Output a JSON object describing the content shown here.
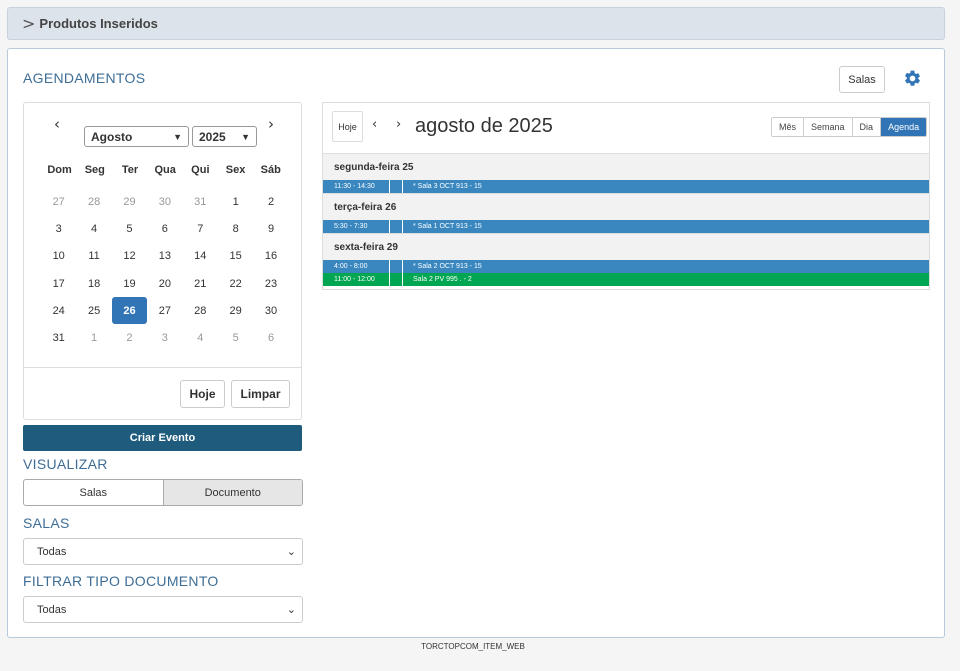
{
  "collapse": {
    "chevron": ">",
    "title": "Produtos Inseridos"
  },
  "section_title": "AGENDAMENTOS",
  "header_buttons": {
    "salas": "Salas",
    "gear": "gear-icon"
  },
  "mini_calendar": {
    "prev": "‹",
    "next": "›",
    "month": "Agosto",
    "year": "2025",
    "weekdays": [
      "Dom",
      "Seg",
      "Ter",
      "Qua",
      "Qui",
      "Sex",
      "Sáb"
    ],
    "days": [
      {
        "n": "27",
        "out": true
      },
      {
        "n": "28",
        "out": true
      },
      {
        "n": "29",
        "out": true
      },
      {
        "n": "30",
        "out": true
      },
      {
        "n": "31",
        "out": true
      },
      {
        "n": "1"
      },
      {
        "n": "2"
      },
      {
        "n": "3"
      },
      {
        "n": "4"
      },
      {
        "n": "5"
      },
      {
        "n": "6"
      },
      {
        "n": "7"
      },
      {
        "n": "8"
      },
      {
        "n": "9"
      },
      {
        "n": "10"
      },
      {
        "n": "11"
      },
      {
        "n": "12"
      },
      {
        "n": "13"
      },
      {
        "n": "14"
      },
      {
        "n": "15"
      },
      {
        "n": "16"
      },
      {
        "n": "17"
      },
      {
        "n": "18"
      },
      {
        "n": "19"
      },
      {
        "n": "20"
      },
      {
        "n": "21"
      },
      {
        "n": "22"
      },
      {
        "n": "23"
      },
      {
        "n": "24"
      },
      {
        "n": "25"
      },
      {
        "n": "26",
        "selected": true
      },
      {
        "n": "27"
      },
      {
        "n": "28"
      },
      {
        "n": "29"
      },
      {
        "n": "30"
      },
      {
        "n": "31"
      },
      {
        "n": "1",
        "out": true
      },
      {
        "n": "2",
        "out": true
      },
      {
        "n": "3",
        "out": true
      },
      {
        "n": "4",
        "out": true
      },
      {
        "n": "5",
        "out": true
      },
      {
        "n": "6",
        "out": true
      }
    ],
    "hoje": "Hoje",
    "limpar": "Limpar"
  },
  "criar_evento": "Criar Evento",
  "visualizar": {
    "title": "VISUALIZAR",
    "options": [
      "Salas",
      "Documento"
    ]
  },
  "salas": {
    "title": "SALAS",
    "value": "Todas"
  },
  "filtrar": {
    "title": "FILTRAR TIPO DOCUMENTO",
    "value": "Todas"
  },
  "big_calendar": {
    "hoje": "Hoje",
    "prev": "‹",
    "next": "›",
    "title": "agosto de 2025",
    "views": [
      "Mês",
      "Semana",
      "Dia",
      "Agenda"
    ],
    "active_view": "Agenda",
    "agenda": [
      {
        "day": "segunda-feira 25",
        "events": [
          {
            "time": "11:30 - 14:30",
            "title": "* Sala 3 OCT 913 - 15",
            "color": "#3a87c0"
          }
        ]
      },
      {
        "day": "terça-feira 26",
        "events": [
          {
            "time": "5:30 - 7:30",
            "title": "* Sala 1 OCT 913 - 15",
            "color": "#3a87c0"
          }
        ]
      },
      {
        "day": "sexta-feira 29",
        "events": [
          {
            "time": "4:00 - 8:00",
            "title": "* Sala 2 OCT 913 - 15",
            "color": "#3a87c0"
          },
          {
            "time": "11:00 - 12:00",
            "title": "Sala 2 PV 995 . - 2",
            "color": "#00a651"
          }
        ]
      }
    ]
  },
  "footer": "TORCTOPCOM_ITEM_WEB"
}
